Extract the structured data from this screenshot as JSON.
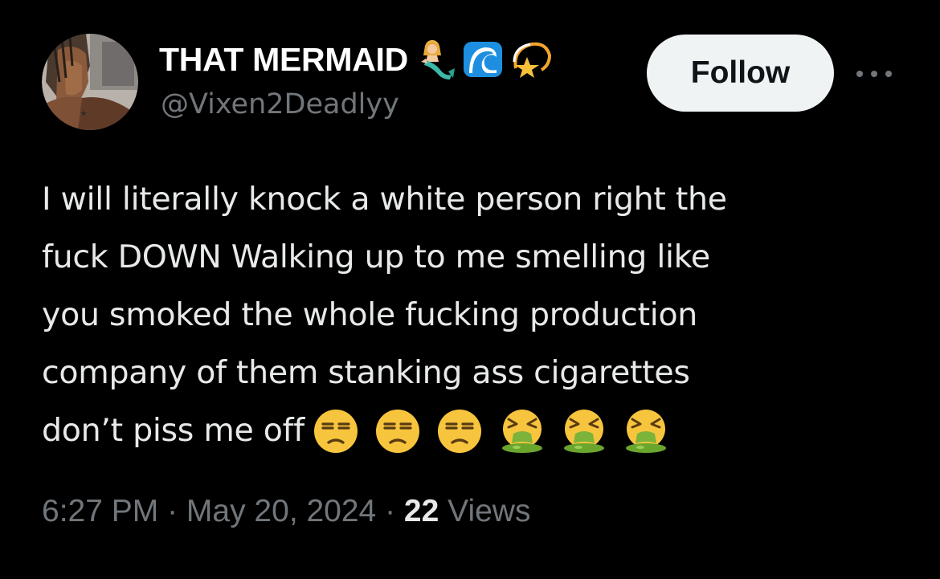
{
  "author": {
    "display_name": "THAT MERMAID",
    "name_emojis": [
      "mermaid-emoji",
      "water-wave-emoji",
      "dizzy-star-emoji"
    ],
    "handle": "@Vixen2Deadlyy",
    "avatar_icon": "profile-photo"
  },
  "actions": {
    "follow_label": "Follow",
    "more_icon": "more-horizontal-icon"
  },
  "tweet": {
    "lines": [
      "I will literally knock a white person right the",
      "fuck DOWN Walking up to me smelling like",
      "you smoked the whole fucking production",
      "company of them stanking ass cigarettes",
      "don’t piss me off"
    ],
    "trailing_emojis": [
      "unamused-face",
      "unamused-face",
      "unamused-face",
      "vomiting-face",
      "vomiting-face",
      "vomiting-face"
    ]
  },
  "meta": {
    "time": "6:27 PM",
    "separator1": " · ",
    "date": "May 20, 2024",
    "separator2": " · ",
    "views_count": "22",
    "views_label": " Views"
  },
  "colors": {
    "background": "#000000",
    "text": "#e7e9ea",
    "secondary": "#71767b",
    "follow_bg": "#eff3f4",
    "follow_text": "#0f1419"
  }
}
